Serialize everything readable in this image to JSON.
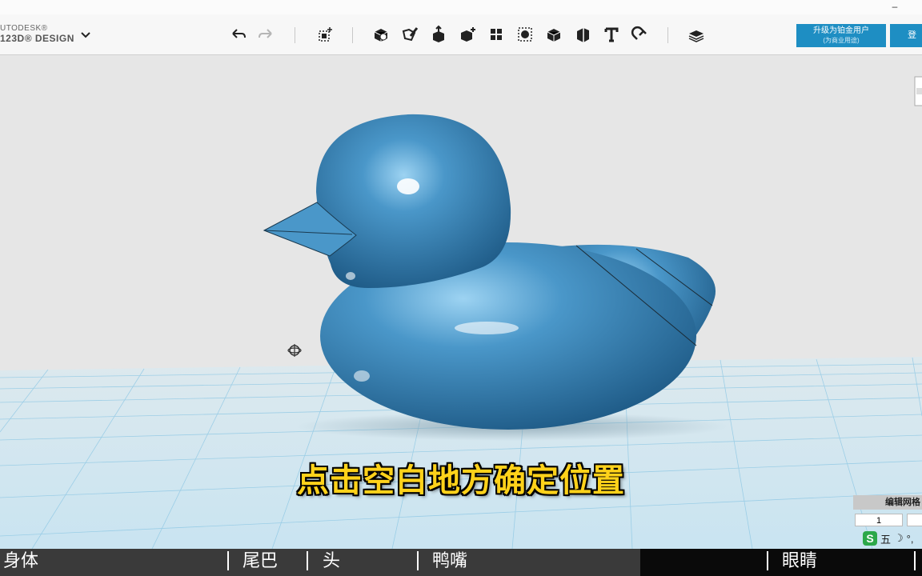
{
  "app": {
    "logo_top": "UTODESK®",
    "logo_main": "123D® DESIGN",
    "upgrade_line1": "升级为铂金用户",
    "upgrade_line2": "(为商业用途)",
    "login_label": "登录",
    "window_minimize": "‒"
  },
  "toolbar": {
    "tools": [
      "undo-icon",
      "redo-icon",
      "transform-icon",
      "primitives-icon",
      "sketch-icon",
      "construct-icon",
      "modify-icon",
      "pattern-icon",
      "group-icon",
      "combine-icon",
      "measure-icon",
      "text-icon",
      "snap-icon",
      "materials-icon"
    ]
  },
  "scene": {
    "subtitle": "点击空白地方确定位置",
    "model_color": "#4a97c9"
  },
  "edit_panel": {
    "title": "编辑网格",
    "value": "1"
  },
  "ime": {
    "logo": "S",
    "mode": "五",
    "moon": "☽",
    "punct": "°,"
  },
  "timeline": {
    "segments": [
      "身体",
      "尾巴",
      "头",
      "鸭嘴",
      "眼睛"
    ]
  }
}
